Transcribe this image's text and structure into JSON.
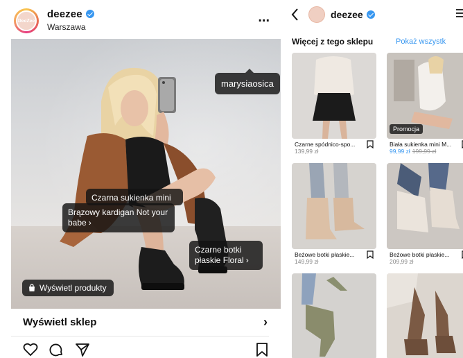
{
  "post": {
    "username": "deezee",
    "avatar_text": "DeeZee",
    "location": "Warszawa",
    "more": "...",
    "tags": {
      "user": "marysiaosica",
      "dress": "Czarna sukienka mini",
      "cardigan": "Brązowy kardigan Not your babe",
      "boots": "Czarne botki płaskie Floral"
    },
    "tag_chevron": "›",
    "view_products": "Wyświetl produkty",
    "view_shop": "Wyświetl sklep",
    "view_shop_arrow": "›"
  },
  "shop": {
    "name": "deezee",
    "section_title": "Więcej z tego sklepu",
    "see_all": "Pokaż wszystk",
    "products": [
      {
        "name": "Czarne spódnico-spo...",
        "price": "139,99 zł"
      },
      {
        "name": "Biała sukienka mini M...",
        "sale_price": "99,99 zł",
        "old_price": "199,99 zł",
        "badge": "Promocja"
      },
      {
        "name": "Beżowe botki płaskie...",
        "price": "149,99 zł"
      },
      {
        "name": "Beżowe botki płaskie...",
        "price": "209,99 zł"
      },
      {
        "name": "",
        "price": ""
      },
      {
        "name": "",
        "price": ""
      }
    ]
  },
  "colors": {
    "accent": "#3897f0",
    "tag_bg": "#141414",
    "text": "#111111"
  },
  "icons": {
    "verified": "verified-badge-icon",
    "more": "more-options-icon",
    "like": "heart-icon",
    "comment": "comment-icon",
    "share": "paper-plane-icon",
    "save": "bookmark-icon",
    "back": "chevron-left-icon",
    "menu": "menu-icon",
    "bag": "shopping-bag-icon"
  }
}
